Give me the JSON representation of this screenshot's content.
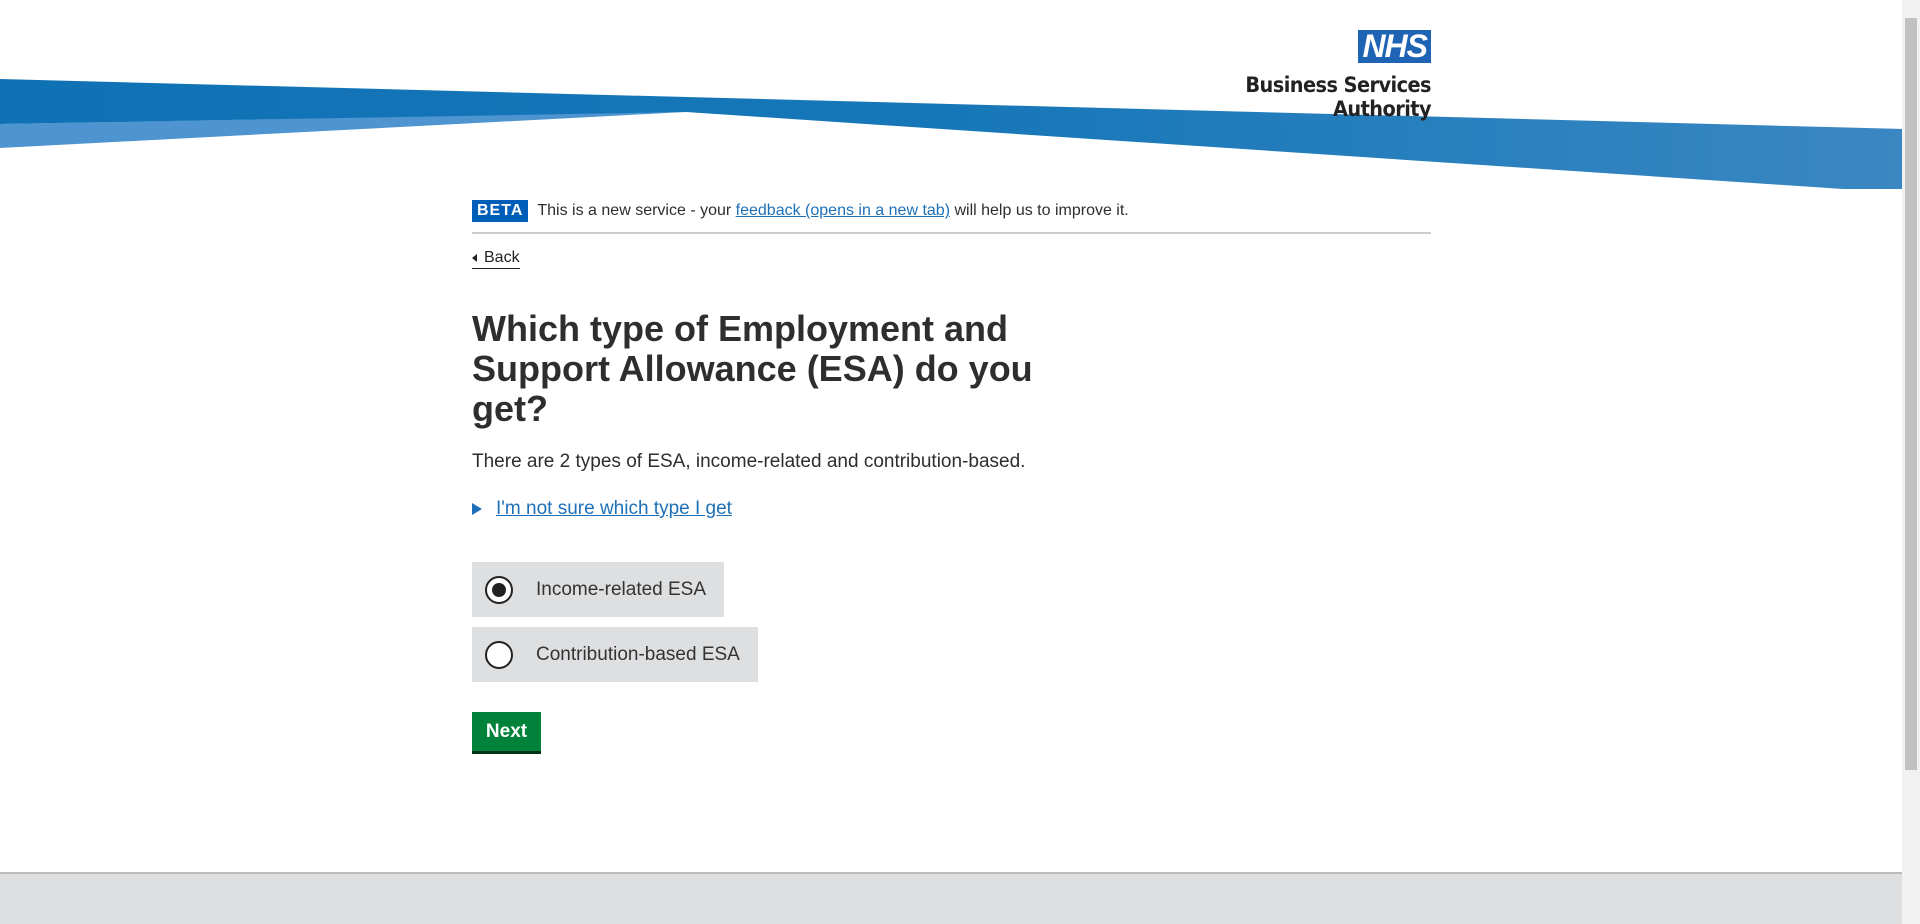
{
  "header": {
    "logo_mark": "NHS",
    "org_name": "Business Services Authority",
    "brand_color": "#1f63b5"
  },
  "beta_banner": {
    "tag": "BETA",
    "text_before": "This is a new service - your ",
    "link": "feedback (opens in a new tab)",
    "text_after": " will help us to improve it."
  },
  "back_link": "Back",
  "question": {
    "title": "Which type of Employment and Support Allowance (ESA) do you get?",
    "intro": "There are 2 types of ESA, income-related and contribution-based.",
    "details_summary": "I'm not sure which type I get"
  },
  "options": [
    {
      "label": "Income-related ESA",
      "selected": true
    },
    {
      "label": "Contribution-based ESA",
      "selected": false
    }
  ],
  "next_button": "Next",
  "colors": {
    "button": "#00823b",
    "link": "#1d70b8",
    "banner_dark": "#0f75b8",
    "banner_light": "#4e94d0"
  }
}
